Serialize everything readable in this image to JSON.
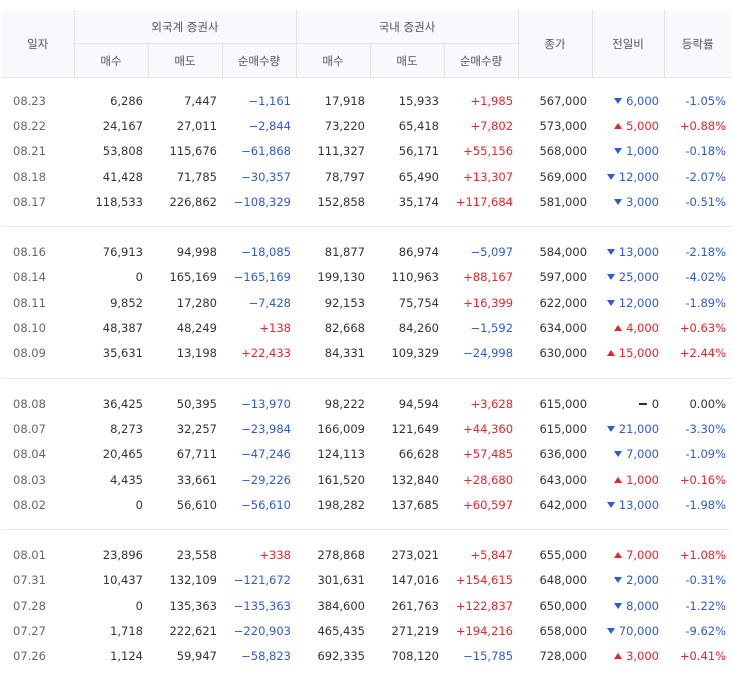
{
  "header": {
    "date": "일자",
    "foreign_group": "외국계 증권사",
    "domestic_group": "국내 증권사",
    "buy": "매수",
    "sell": "매도",
    "net": "순매수량",
    "close": "종가",
    "change": "전일비",
    "rate": "등락률"
  },
  "groups": [
    [
      [
        "08.23",
        "6,286",
        "7,447",
        "−1,161",
        "17,918",
        "15,933",
        "+1,985",
        "567,000",
        "down",
        "6,000",
        "-1.05%"
      ],
      [
        "08.22",
        "24,167",
        "27,011",
        "−2,844",
        "73,220",
        "65,418",
        "+7,802",
        "573,000",
        "up",
        "5,000",
        "+0.88%"
      ],
      [
        "08.21",
        "53,808",
        "115,676",
        "−61,868",
        "111,327",
        "56,171",
        "+55,156",
        "568,000",
        "down",
        "1,000",
        "-0.18%"
      ],
      [
        "08.18",
        "41,428",
        "71,785",
        "−30,357",
        "78,797",
        "65,490",
        "+13,307",
        "569,000",
        "down",
        "12,000",
        "-2.07%"
      ],
      [
        "08.17",
        "118,533",
        "226,862",
        "−108,329",
        "152,858",
        "35,174",
        "+117,684",
        "581,000",
        "down",
        "3,000",
        "-0.51%"
      ]
    ],
    [
      [
        "08.16",
        "76,913",
        "94,998",
        "−18,085",
        "81,877",
        "86,974",
        "−5,097",
        "584,000",
        "down",
        "13,000",
        "-2.18%"
      ],
      [
        "08.14",
        "0",
        "165,169",
        "−165,169",
        "199,130",
        "110,963",
        "+88,167",
        "597,000",
        "down",
        "25,000",
        "-4.02%"
      ],
      [
        "08.11",
        "9,852",
        "17,280",
        "−7,428",
        "92,153",
        "75,754",
        "+16,399",
        "622,000",
        "down",
        "12,000",
        "-1.89%"
      ],
      [
        "08.10",
        "48,387",
        "48,249",
        "+138",
        "82,668",
        "84,260",
        "−1,592",
        "634,000",
        "up",
        "4,000",
        "+0.63%"
      ],
      [
        "08.09",
        "35,631",
        "13,198",
        "+22,433",
        "84,331",
        "109,329",
        "−24,998",
        "630,000",
        "up",
        "15,000",
        "+2.44%"
      ]
    ],
    [
      [
        "08.08",
        "36,425",
        "50,395",
        "−13,970",
        "98,222",
        "94,594",
        "+3,628",
        "615,000",
        "flat",
        "0",
        "0.00%"
      ],
      [
        "08.07",
        "8,273",
        "32,257",
        "−23,984",
        "166,009",
        "121,649",
        "+44,360",
        "615,000",
        "down",
        "21,000",
        "-3.30%"
      ],
      [
        "08.04",
        "20,465",
        "67,711",
        "−47,246",
        "124,113",
        "66,628",
        "+57,485",
        "636,000",
        "down",
        "7,000",
        "-1.09%"
      ],
      [
        "08.03",
        "4,435",
        "33,661",
        "−29,226",
        "161,520",
        "132,840",
        "+28,680",
        "643,000",
        "up",
        "1,000",
        "+0.16%"
      ],
      [
        "08.02",
        "0",
        "56,610",
        "−56,610",
        "198,282",
        "137,685",
        "+60,597",
        "642,000",
        "down",
        "13,000",
        "-1.98%"
      ]
    ],
    [
      [
        "08.01",
        "23,896",
        "23,558",
        "+338",
        "278,868",
        "273,021",
        "+5,847",
        "655,000",
        "up",
        "7,000",
        "+1.08%"
      ],
      [
        "07.31",
        "10,437",
        "132,109",
        "−121,672",
        "301,631",
        "147,016",
        "+154,615",
        "648,000",
        "down",
        "2,000",
        "-0.31%"
      ],
      [
        "07.28",
        "0",
        "135,363",
        "−135,363",
        "384,600",
        "261,763",
        "+122,837",
        "650,000",
        "down",
        "8,000",
        "-1.22%"
      ],
      [
        "07.27",
        "1,718",
        "222,621",
        "−220,903",
        "465,435",
        "271,219",
        "+194,216",
        "658,000",
        "down",
        "70,000",
        "-9.62%"
      ],
      [
        "07.26",
        "1,124",
        "59,947",
        "−58,823",
        "692,335",
        "708,120",
        "−15,785",
        "728,000",
        "up",
        "3,000",
        "+0.41%"
      ]
    ]
  ],
  "colors": {
    "up": "#e5262e",
    "down": "#2f5bd0",
    "flat": "#333333"
  },
  "icons": {
    "up": "triangle-up-icon",
    "down": "triangle-down-icon",
    "flat": "dash-icon"
  }
}
